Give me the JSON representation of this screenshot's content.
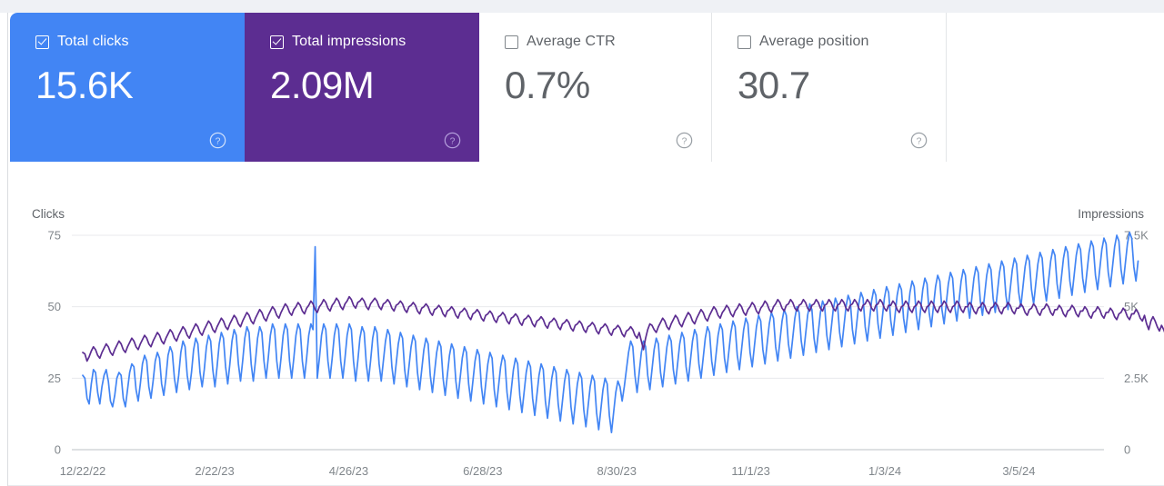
{
  "cards": [
    {
      "id": "total-clicks",
      "label": "Total clicks",
      "value": "15.6K",
      "checked": true,
      "color": "#4285f4",
      "help": "help-icon"
    },
    {
      "id": "total-impressions",
      "label": "Total impressions",
      "value": "2.09M",
      "checked": true,
      "color": "#5c2d91",
      "help": "help-icon"
    },
    {
      "id": "average-ctr",
      "label": "Average CTR",
      "value": "0.7%",
      "checked": false,
      "color": "#ffffff",
      "help": "help-icon"
    },
    {
      "id": "average-position",
      "label": "Average position",
      "value": "30.7",
      "checked": false,
      "color": "#ffffff",
      "help": "help-icon"
    }
  ],
  "chart_data": {
    "type": "line",
    "title": "",
    "xlabel": "",
    "ylabel": "Clicks",
    "y2label": "Impressions",
    "grid": true,
    "legend": "none",
    "ylim": [
      0,
      75
    ],
    "y2lim": [
      0,
      7500
    ],
    "yticks": [
      "0",
      "25",
      "50",
      "75"
    ],
    "ytick_values": [
      0,
      25,
      50,
      75
    ],
    "y2ticks": [
      "0",
      "2.5K",
      "5K",
      "7.5K"
    ],
    "y2tick_values": [
      0,
      2500,
      5000,
      7500
    ],
    "xticks": [
      "12/22/22",
      "2/22/23",
      "4/26/23",
      "6/28/23",
      "8/30/23",
      "11/1/23",
      "1/3/24",
      "3/5/24"
    ],
    "xtick_positions": [
      0,
      62,
      125,
      188,
      251,
      314,
      377,
      440
    ],
    "x_start_date": "12/22/22",
    "n_points": 480,
    "series": [
      {
        "name": "Clicks",
        "color": "#4285f4",
        "axis": "left",
        "unit": "clicks",
        "values": [
          26,
          25,
          18,
          16,
          23,
          28,
          27,
          20,
          16,
          22,
          26,
          28,
          24,
          17,
          15,
          19,
          25,
          27,
          26,
          18,
          15,
          21,
          27,
          30,
          29,
          21,
          17,
          23,
          30,
          33,
          31,
          22,
          18,
          24,
          31,
          34,
          32,
          23,
          19,
          25,
          33,
          36,
          34,
          25,
          20,
          26,
          34,
          38,
          36,
          26,
          21,
          27,
          35,
          39,
          37,
          27,
          22,
          28,
          36,
          40,
          38,
          28,
          22,
          29,
          37,
          41,
          39,
          29,
          23,
          30,
          38,
          42,
          40,
          30,
          24,
          31,
          39,
          43,
          41,
          30,
          24,
          31,
          39,
          43,
          41,
          31,
          25,
          32,
          40,
          44,
          42,
          31,
          25,
          32,
          40,
          44,
          42,
          31,
          25,
          32,
          40,
          44,
          42,
          31,
          25,
          32,
          40,
          44,
          42,
          71,
          25,
          32,
          40,
          44,
          42,
          31,
          25,
          32,
          40,
          44,
          42,
          31,
          25,
          32,
          40,
          44,
          42,
          31,
          24,
          31,
          39,
          43,
          41,
          30,
          24,
          31,
          39,
          43,
          41,
          30,
          24,
          31,
          38,
          42,
          40,
          29,
          23,
          30,
          37,
          41,
          39,
          28,
          22,
          29,
          36,
          40,
          38,
          27,
          21,
          28,
          35,
          39,
          37,
          26,
          20,
          27,
          34,
          38,
          36,
          25,
          19,
          26,
          33,
          37,
          35,
          24,
          18,
          25,
          32,
          36,
          34,
          23,
          17,
          24,
          31,
          35,
          33,
          22,
          16,
          23,
          30,
          34,
          32,
          21,
          15,
          22,
          29,
          33,
          31,
          20,
          14,
          21,
          28,
          32,
          30,
          19,
          13,
          20,
          27,
          31,
          29,
          18,
          12,
          19,
          26,
          30,
          28,
          17,
          11,
          18,
          25,
          29,
          27,
          16,
          10,
          17,
          24,
          28,
          26,
          15,
          9,
          16,
          23,
          27,
          25,
          14,
          8,
          15,
          22,
          26,
          24,
          13,
          7,
          14,
          21,
          25,
          23,
          12,
          6,
          13,
          20,
          24,
          22,
          17,
          22,
          28,
          34,
          38,
          36,
          26,
          20,
          27,
          34,
          38,
          36,
          26,
          21,
          28,
          35,
          39,
          37,
          27,
          22,
          29,
          36,
          40,
          38,
          28,
          23,
          30,
          37,
          41,
          39,
          29,
          24,
          31,
          38,
          42,
          40,
          30,
          25,
          32,
          39,
          43,
          41,
          31,
          26,
          33,
          40,
          44,
          42,
          32,
          27,
          34,
          41,
          45,
          43,
          33,
          28,
          35,
          42,
          46,
          44,
          34,
          29,
          36,
          43,
          47,
          45,
          35,
          30,
          37,
          44,
          48,
          46,
          36,
          31,
          38,
          45,
          49,
          47,
          37,
          32,
          39,
          46,
          50,
          48,
          38,
          33,
          40,
          47,
          51,
          49,
          39,
          34,
          41,
          48,
          52,
          50,
          40,
          35,
          42,
          49,
          53,
          51,
          41,
          36,
          43,
          50,
          54,
          52,
          42,
          37,
          44,
          51,
          55,
          53,
          43,
          38,
          45,
          52,
          56,
          54,
          44,
          39,
          46,
          53,
          57,
          55,
          45,
          40,
          47,
          54,
          58,
          56,
          46,
          41,
          48,
          55,
          59,
          57,
          47,
          42,
          49,
          56,
          60,
          58,
          48,
          43,
          50,
          57,
          61,
          59,
          49,
          44,
          51,
          58,
          62,
          60,
          50,
          45,
          52,
          59,
          63,
          61,
          51,
          46,
          53,
          60,
          64,
          62,
          52,
          47,
          54,
          61,
          65,
          63,
          53,
          48,
          55,
          62,
          66,
          64,
          54,
          49,
          56,
          63,
          67,
          65,
          55,
          50,
          57,
          64,
          68,
          66,
          56,
          51,
          58,
          65,
          69,
          67,
          57,
          52,
          59,
          66,
          70,
          68,
          58,
          53,
          60,
          67,
          71,
          69,
          59,
          54,
          61,
          68,
          72,
          70,
          60,
          55,
          62,
          69,
          73,
          71,
          61,
          56,
          63,
          70,
          74,
          72,
          62,
          57,
          64,
          71,
          75,
          73,
          63,
          58,
          65,
          72,
          76,
          74,
          64,
          59,
          66
        ]
      },
      {
        "name": "Impressions",
        "color": "#5c2d91",
        "axis": "right",
        "unit": "impressions",
        "values": [
          3400,
          3350,
          3100,
          3250,
          3450,
          3600,
          3500,
          3300,
          3200,
          3400,
          3550,
          3700,
          3600,
          3400,
          3300,
          3500,
          3650,
          3800,
          3700,
          3500,
          3400,
          3600,
          3750,
          3900,
          3800,
          3600,
          3500,
          3700,
          3850,
          4000,
          3900,
          3700,
          3600,
          3800,
          3950,
          4100,
          4000,
          3800,
          3700,
          3900,
          4050,
          4200,
          4100,
          3900,
          3800,
          4000,
          4150,
          4300,
          4200,
          4000,
          3900,
          4100,
          4250,
          4400,
          4300,
          4100,
          4000,
          4200,
          4350,
          4500,
          4400,
          4200,
          4100,
          4300,
          4450,
          4600,
          4500,
          4300,
          4200,
          4400,
          4550,
          4700,
          4600,
          4400,
          4300,
          4500,
          4650,
          4800,
          4700,
          4500,
          4400,
          4600,
          4750,
          4900,
          4800,
          4600,
          4500,
          4700,
          4850,
          5000,
          4900,
          4700,
          4600,
          4800,
          4950,
          5100,
          5000,
          4800,
          4700,
          4900,
          5000,
          5150,
          5050,
          4850,
          4750,
          4950,
          5050,
          5200,
          5100,
          4900,
          4800,
          5000,
          5100,
          5250,
          5150,
          4950,
          4850,
          5050,
          5150,
          5300,
          5200,
          5000,
          4900,
          5100,
          5200,
          5350,
          5250,
          5050,
          4950,
          5150,
          5200,
          5300,
          5200,
          5000,
          4900,
          5100,
          5200,
          5300,
          5200,
          5000,
          4900,
          5100,
          5150,
          5250,
          5150,
          4950,
          4850,
          5050,
          5100,
          5200,
          5100,
          4900,
          4800,
          5000,
          5050,
          5150,
          5050,
          4850,
          4750,
          4950,
          5000,
          5100,
          5000,
          4800,
          4700,
          4900,
          4950,
          5050,
          4950,
          4750,
          4650,
          4850,
          4900,
          5000,
          4900,
          4700,
          4600,
          4800,
          4850,
          4950,
          4850,
          4650,
          4550,
          4750,
          4800,
          4900,
          4800,
          4600,
          4500,
          4700,
          4750,
          4850,
          4750,
          4550,
          4450,
          4650,
          4700,
          4800,
          4700,
          4500,
          4400,
          4600,
          4650,
          4750,
          4650,
          4450,
          4350,
          4550,
          4600,
          4700,
          4600,
          4400,
          4300,
          4500,
          4550,
          4650,
          4550,
          4350,
          4250,
          4450,
          4500,
          4600,
          4500,
          4300,
          4200,
          4400,
          4450,
          4550,
          4450,
          4250,
          4150,
          4350,
          4400,
          4500,
          4400,
          4200,
          4100,
          4300,
          4350,
          4450,
          4350,
          4150,
          4050,
          4250,
          4300,
          4400,
          4300,
          4100,
          4000,
          4200,
          4250,
          4350,
          4250,
          4050,
          3950,
          4150,
          4200,
          4300,
          4200,
          4000,
          3900,
          4100,
          3800,
          3500,
          3900,
          4200,
          4400,
          4350,
          4200,
          4100,
          4300,
          4450,
          4600,
          4500,
          4300,
          4200,
          4400,
          4550,
          4700,
          4600,
          4400,
          4300,
          4500,
          4650,
          4800,
          4700,
          4500,
          4400,
          4600,
          4750,
          4900,
          4800,
          4600,
          4500,
          4700,
          4850,
          5000,
          4900,
          4700,
          4600,
          4800,
          4900,
          5050,
          4950,
          4750,
          4650,
          4850,
          4950,
          5100,
          5000,
          4800,
          4700,
          4900,
          5000,
          5150,
          5050,
          4850,
          4750,
          4950,
          5050,
          5200,
          5100,
          4900,
          4800,
          5000,
          5100,
          5250,
          5150,
          4950,
          4850,
          5050,
          5100,
          5250,
          5150,
          4950,
          4850,
          5050,
          5100,
          5250,
          5150,
          4950,
          4850,
          5050,
          5100,
          5250,
          5150,
          4950,
          4850,
          5050,
          5100,
          5250,
          5150,
          4950,
          4850,
          5050,
          5100,
          5250,
          5150,
          4950,
          4850,
          5050,
          5100,
          5250,
          5150,
          4950,
          4850,
          5050,
          5100,
          5250,
          5150,
          4950,
          4850,
          5050,
          5100,
          5250,
          5150,
          4950,
          4850,
          5050,
          5050,
          5200,
          5100,
          4900,
          4800,
          5000,
          5050,
          5200,
          5100,
          4900,
          4800,
          5000,
          5050,
          5200,
          5100,
          4900,
          4800,
          5000,
          5050,
          5200,
          5100,
          4900,
          4800,
          5000,
          5050,
          5200,
          5100,
          4900,
          4800,
          5000,
          5050,
          5200,
          5100,
          4900,
          4800,
          5000,
          5000,
          5150,
          5050,
          4850,
          4750,
          4950,
          5000,
          5150,
          5050,
          4850,
          4750,
          4950,
          5000,
          5150,
          5050,
          4850,
          4750,
          4950,
          5000,
          5150,
          5050,
          4850,
          4750,
          4950,
          4950,
          5100,
          5000,
          4800,
          4700,
          4900,
          4950,
          5100,
          5000,
          4800,
          4700,
          4900,
          4950,
          5100,
          5000,
          4800,
          4700,
          4900,
          4900,
          5050,
          4950,
          4750,
          4650,
          4850,
          4900,
          5050,
          4950,
          4750,
          4650,
          4850,
          4850,
          5000,
          4900,
          4700,
          4600,
          4800,
          4850,
          5000,
          4900,
          4700,
          4600,
          4800,
          4800,
          4950,
          4850,
          4650,
          4550,
          4750,
          4800,
          4950,
          4850,
          4650,
          4550,
          4750,
          4750,
          4900,
          4800,
          4600,
          4500,
          4700,
          4400,
          4200,
          4500,
          4650,
          4500,
          4300,
          4150,
          4350,
          4200,
          4000,
          3900,
          4100,
          3950,
          3700
        ]
      }
    ]
  }
}
